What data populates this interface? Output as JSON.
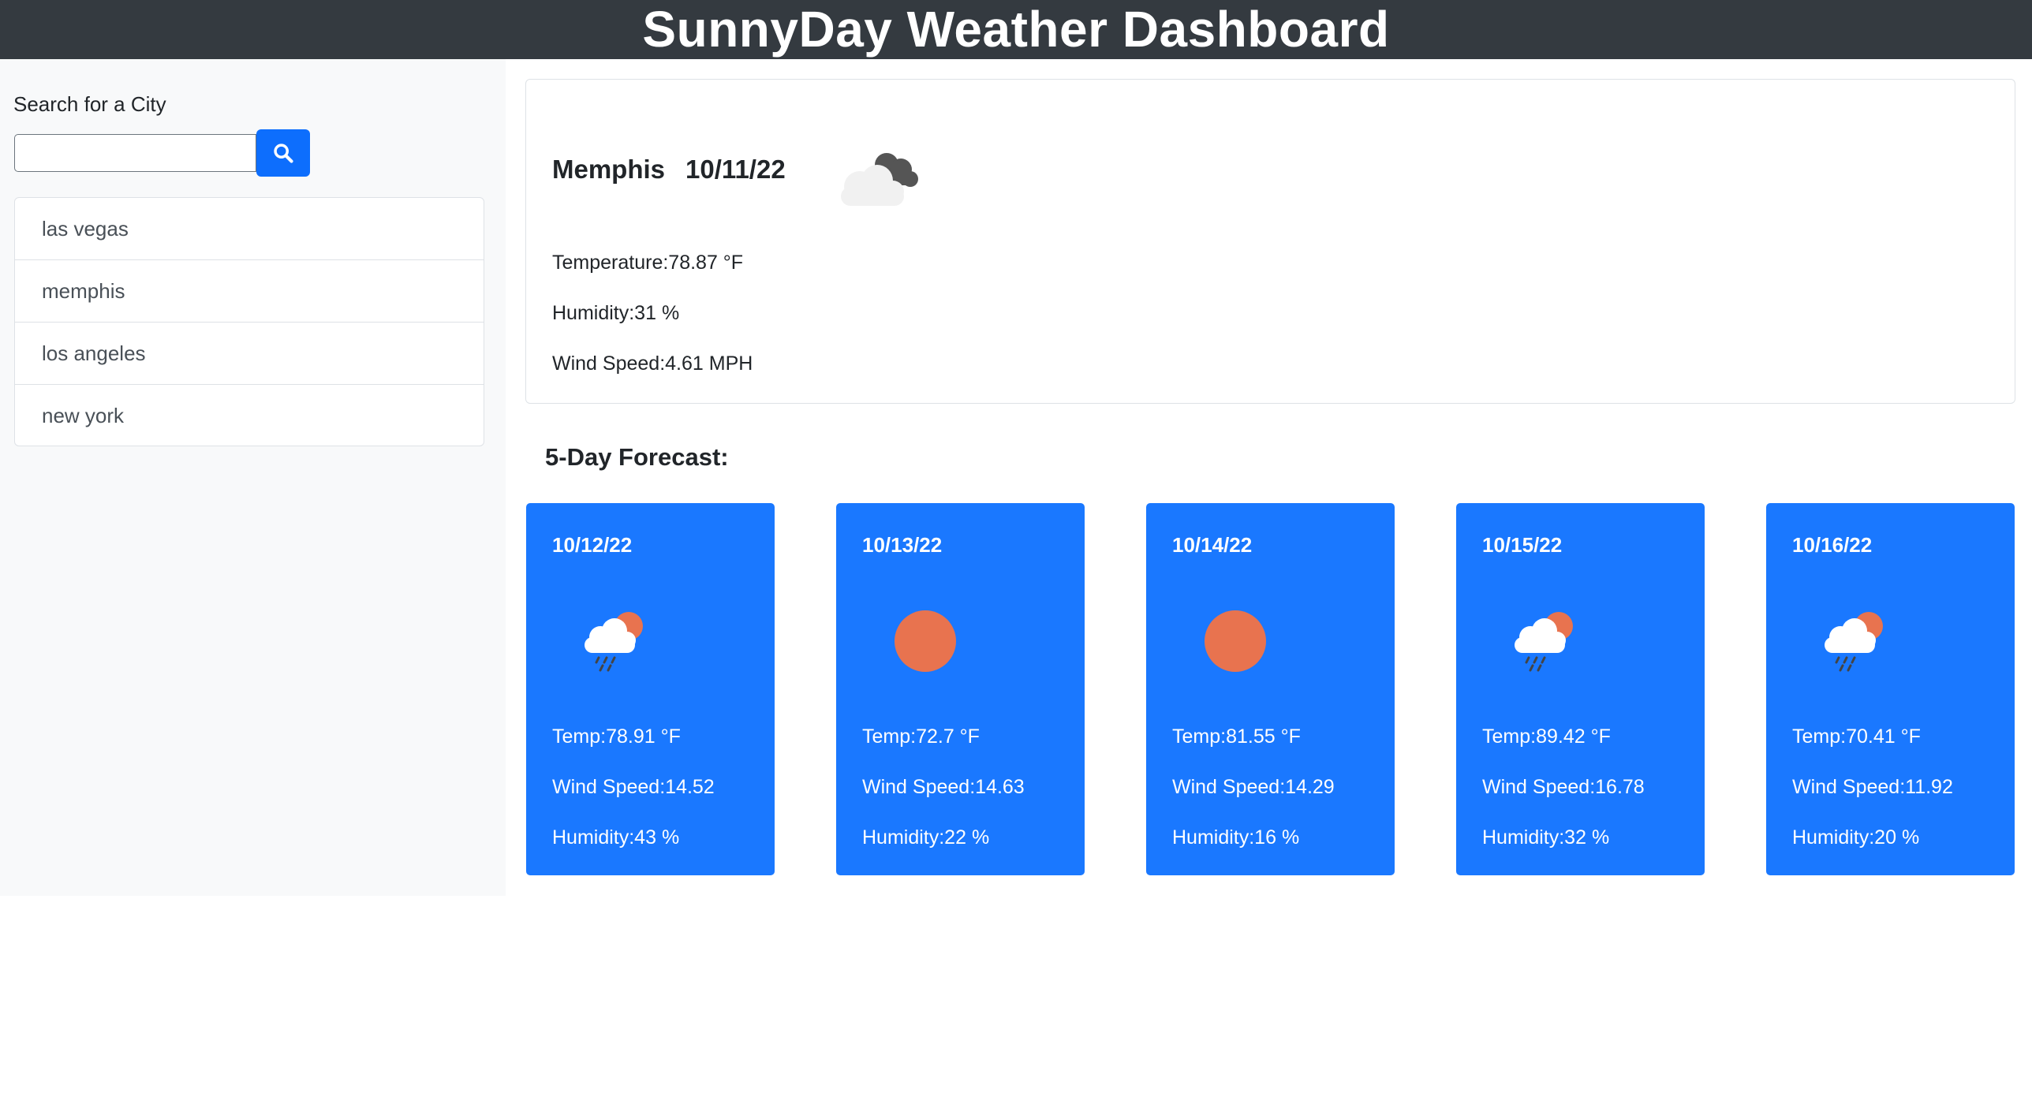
{
  "header": {
    "title": "SunnyDay Weather Dashboard"
  },
  "search": {
    "label": "Search for a City",
    "value": "",
    "placeholder": "",
    "button_icon": "search-icon"
  },
  "history": [
    "las vegas",
    "memphis",
    "los angeles",
    "new york"
  ],
  "current": {
    "city": "Memphis",
    "date": "10/11/22",
    "icon": "cloudy-icon",
    "temperature": "Temperature:78.87 °F",
    "humidity": "Humidity:31 %",
    "wind": "Wind Speed:4.61 MPH"
  },
  "forecast_heading": "5-Day Forecast:",
  "forecast": [
    {
      "date": "10/12/22",
      "icon": "rain-sun-icon",
      "temp": "Temp:78.91 °F",
      "wind": "Wind Speed:14.52",
      "humidity": "Humidity:43 %"
    },
    {
      "date": "10/13/22",
      "icon": "sun-icon",
      "temp": "Temp:72.7 °F",
      "wind": "Wind Speed:14.63",
      "humidity": "Humidity:22 %"
    },
    {
      "date": "10/14/22",
      "icon": "sun-icon",
      "temp": "Temp:81.55 °F",
      "wind": "Wind Speed:14.29",
      "humidity": "Humidity:16 %"
    },
    {
      "date": "10/15/22",
      "icon": "rain-sun-icon",
      "temp": "Temp:89.42 °F",
      "wind": "Wind Speed:16.78",
      "humidity": "Humidity:32 %"
    },
    {
      "date": "10/16/22",
      "icon": "rain-sun-icon",
      "temp": "Temp:70.41 °F",
      "wind": "Wind Speed:11.92",
      "humidity": "Humidity:20 %"
    }
  ],
  "colors": {
    "header": "#343a40",
    "accent": "#0d6efd",
    "card": "#1a78ff",
    "sun": "#e8734f"
  }
}
